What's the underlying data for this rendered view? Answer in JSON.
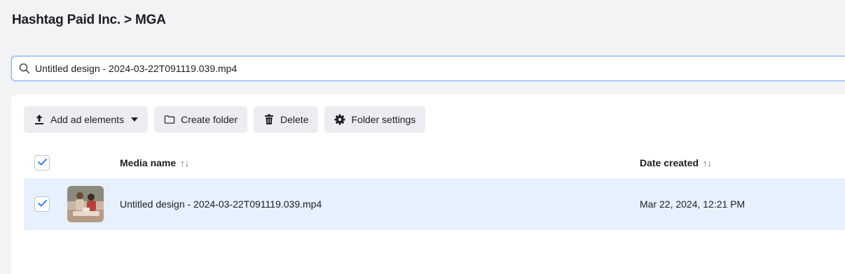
{
  "breadcrumb": {
    "text": "Hashtag Paid Inc. > MGA"
  },
  "search": {
    "value": "Untitled design - 2024-03-22T091119.039.mp4",
    "icon": "search-icon"
  },
  "toolbar": {
    "add_label": "Add ad elements",
    "create_folder_label": "Create folder",
    "delete_label": "Delete",
    "folder_settings_label": "Folder settings"
  },
  "table": {
    "columns": [
      {
        "label": "Media name",
        "sort": "↑↓"
      },
      {
        "label": "Date created",
        "sort": "↑↓"
      }
    ],
    "rows": [
      {
        "selected": true,
        "name": "Untitled design - 2024-03-22T091119.039.mp4",
        "date": "Mar 22, 2024, 12:21 PM"
      }
    ]
  },
  "colors": {
    "accent": "#1877f2",
    "selected_row": "#e7f0fd",
    "button_bg": "#ebedf0"
  }
}
